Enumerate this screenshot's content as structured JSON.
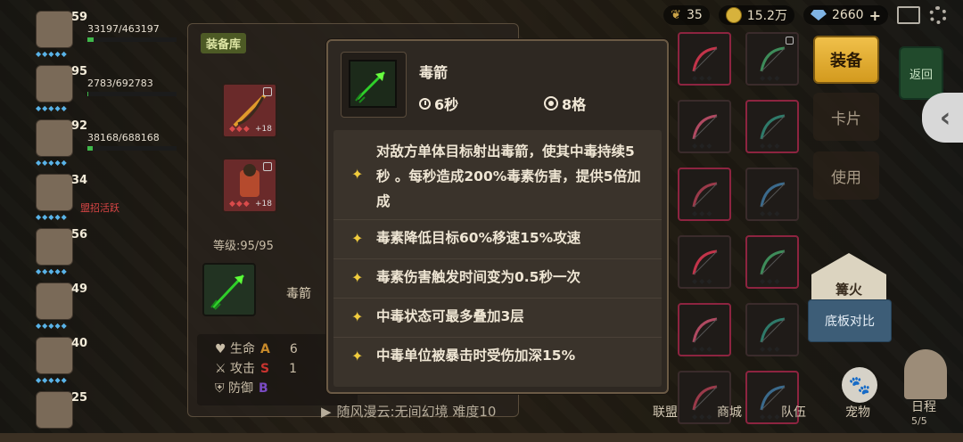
{
  "top_bar": {
    "resource_1": "35",
    "coins": "15.2万",
    "gems": "2660",
    "plus": "+"
  },
  "players": [
    {
      "level": "59",
      "hp": "33197/463197"
    },
    {
      "level": "95",
      "hp": "2783/692783"
    },
    {
      "level": "92",
      "hp": "38168/688168"
    },
    {
      "level": "34",
      "hp": ""
    },
    {
      "level": "56",
      "hp": ""
    },
    {
      "level": "49",
      "hp": ""
    },
    {
      "level": "40",
      "hp": ""
    },
    {
      "level": "25",
      "hp": ""
    }
  ],
  "left_overlay_text": "盟招活跃",
  "equipment": {
    "tab_label": "装备库",
    "enhance": "+18",
    "level_label": "等级:95/95",
    "skill_name": "毒箭",
    "stats": [
      {
        "name": "生命",
        "grade": "A",
        "value": "6",
        "color": "#c88a2a"
      },
      {
        "name": "攻击",
        "grade": "S",
        "value": "1",
        "color": "#c8342f"
      },
      {
        "name": "防御",
        "grade": "B",
        "value": "",
        "color": "#7a4bc4"
      }
    ]
  },
  "side_buttons": {
    "equip": "装备",
    "card": "卡片",
    "use": "使用",
    "back": "返回",
    "bonfire": "篝火",
    "compare": "底板对比"
  },
  "bottom_nav": {
    "quest": "随风漫云:无间幻境 难度10",
    "alliance": "联盟",
    "shop": "商城",
    "team": "队伍",
    "pet": "宠物",
    "schedule": "日程",
    "schedule_count": "5/5"
  },
  "tooltip": {
    "name": "毒箭",
    "cooldown": "6秒",
    "range": "8格",
    "effects": [
      "对敌方单体目标射出毒箭，使其中毒持续5秒 。每秒造成200%毒素伤害，提供5倍加成",
      "毒素降低目标60%移速15%攻速",
      "毒素伤害触发时间变为0.5秒一次",
      "中毒状态可最多叠加3层",
      "中毒单位被暴击时受伤加深15%"
    ]
  },
  "colors": {
    "accent_gold": "#f1cc3d",
    "equip_button": "#e3ad30",
    "hp_green": "#3fb84a"
  }
}
